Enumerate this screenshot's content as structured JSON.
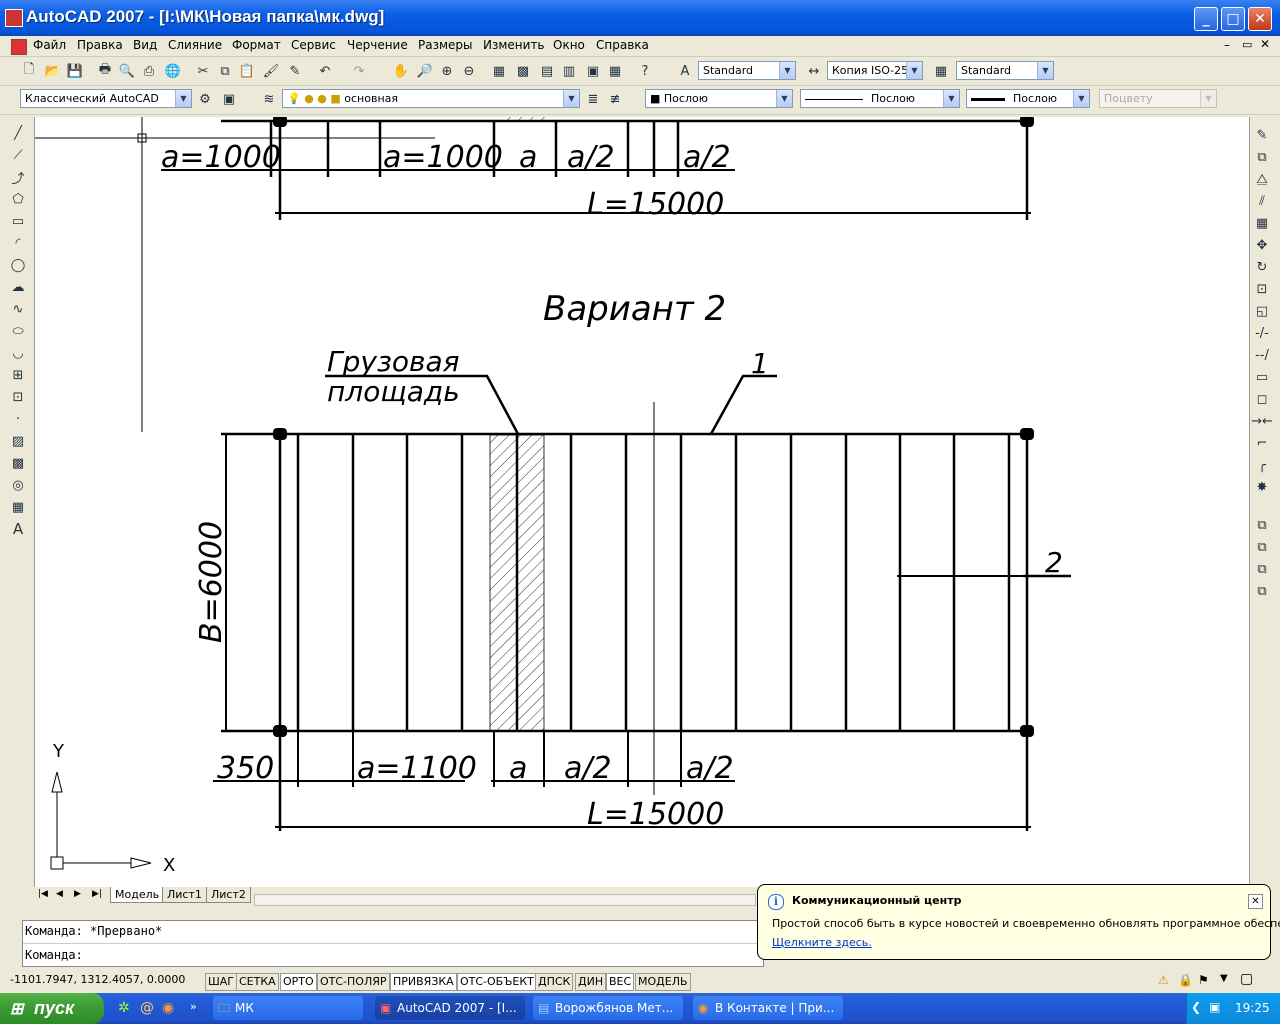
{
  "window": {
    "title": "AutoCAD 2007 - [I:\\МК\\Новая папка\\мк.dwg]"
  },
  "menu": [
    "Файл",
    "Правка",
    "Вид",
    "Слияние",
    "Формат",
    "Сервис",
    "Черчение",
    "Размеры",
    "Изменить",
    "Окно",
    "Справка"
  ],
  "toolbar": {
    "text_style": "Standard",
    "dim_style": "Копия ISO-25",
    "table_style": "Standard",
    "workspace": "Классический AutoCAD",
    "layer": "основная",
    "color": "Послою",
    "linetype": "Послою",
    "lineweight": "Послою",
    "plotstyle": "Поцвету"
  },
  "drawing": {
    "top": {
      "dim_a1": "a=1000",
      "dim_a2": "a=1000",
      "dim_a": "a",
      "dim_half1": "a/2",
      "dim_half2": "a/2",
      "dim_L": "L=15000"
    },
    "title": "Вариант 2",
    "leader_label_line1": "Грузовая",
    "leader_label_line2": "площадь",
    "label_1": "1",
    "label_2": "2",
    "dim_B": "B=6000",
    "bottom": {
      "dim_350": "350",
      "dim_a": "a=1100",
      "dim_a_single": "a",
      "dim_half1": "a/2",
      "dim_half2": "a/2",
      "dim_L": "L=15000"
    },
    "ucs_x": "X",
    "ucs_y": "Y"
  },
  "tabs": [
    "Модель",
    "Лист1",
    "Лист2"
  ],
  "command": {
    "line1": "Команда:  *Прервано*",
    "line2": "Команда:"
  },
  "status": {
    "coords": "-1101.7947, 1312.4057, 0.0000",
    "buttons": [
      "ШАГ",
      "СЕТКА",
      "ОРТО",
      "ОТС-ПОЛЯР",
      "ПРИВЯЗКА",
      "ОТС-ОБЪЕКТ",
      "ДПСК",
      "ДИН",
      "ВЕС",
      "МОДЕЛЬ"
    ]
  },
  "balloon": {
    "title": "Коммуникационный центр",
    "text": "Простой способ быть в курсе новостей и своевременно обновлять программное обеспечение.",
    "link": "Щелкните здесь."
  },
  "taskbar": {
    "start": "пуск",
    "items": [
      "МК",
      "AutoCAD 2007 - [I...",
      "Ворожбянов Мет...",
      "В Контакте | При..."
    ],
    "clock": "19:25"
  }
}
